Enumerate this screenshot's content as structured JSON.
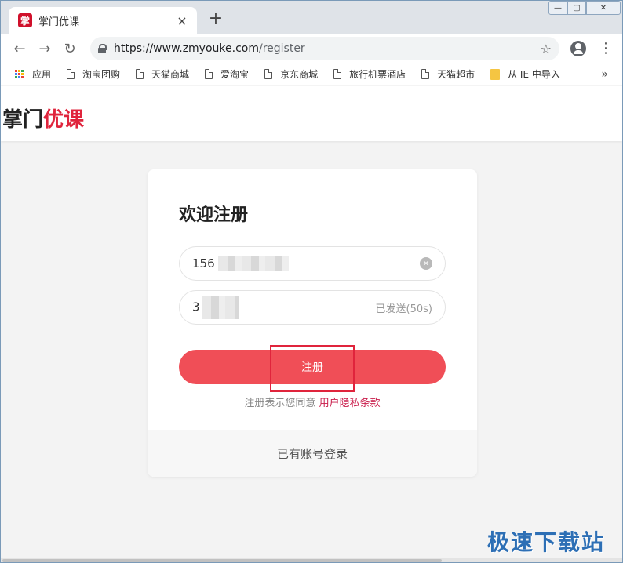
{
  "browser": {
    "tab": {
      "favicon": "掌",
      "title": "掌门优课",
      "close": "×"
    },
    "new_tab": "+",
    "window_controls": {
      "minimize": "—",
      "maximize": "▢",
      "close": "✕"
    },
    "url": {
      "base": "https://www.zmyouke.com",
      "path": "/register"
    },
    "bookmarks": [
      {
        "label": "应用"
      },
      {
        "label": "淘宝团购"
      },
      {
        "label": "天猫商城"
      },
      {
        "label": "爱淘宝"
      },
      {
        "label": "京东商城"
      },
      {
        "label": "旅行机票酒店"
      },
      {
        "label": "天猫超市"
      },
      {
        "label": "从 IE 中导入"
      }
    ],
    "bookmarks_more": "»"
  },
  "site": {
    "logo_part1": "掌门",
    "logo_part2": "优课"
  },
  "register_card": {
    "title": "欢迎注册",
    "phone_value": "156",
    "clear_symbol": "×",
    "code_value": "3",
    "sent_status": "已发送(50s)",
    "register_label": "注册",
    "agreement_prefix": "注册表示您同意",
    "agreement_link": "用户隐私条款",
    "login_link": "已有账号登录"
  },
  "watermark": "极速下载站",
  "colors": {
    "brand_red": "#e0243c",
    "button_red": "#f04e57",
    "link_red": "#c91d4b"
  }
}
